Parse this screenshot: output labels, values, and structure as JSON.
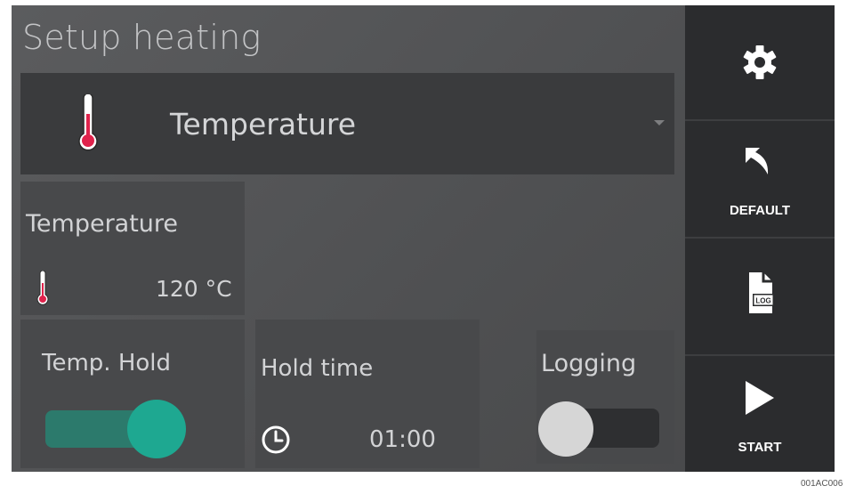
{
  "header": {
    "title": "Setup heating"
  },
  "mode_select": {
    "selected": "Temperature"
  },
  "temperature_tile": {
    "label": "Temperature",
    "value": "120 °C"
  },
  "temp_hold_tile": {
    "label": "Temp. Hold",
    "enabled": true
  },
  "hold_time_tile": {
    "label": "Hold time",
    "value": "01:00"
  },
  "logging_tile": {
    "label": "Logging",
    "enabled": false
  },
  "sidebar": {
    "settings": {
      "icon": "gear-icon"
    },
    "default": {
      "label": "DEFAULT",
      "icon": "undo-arrow-icon"
    },
    "log": {
      "icon": "log-file-icon"
    },
    "start": {
      "label": "START",
      "icon": "play-icon"
    }
  },
  "footer": {
    "code": "001AC006"
  },
  "colors": {
    "accent_teal": "#1ea891",
    "thermometer_red": "#e0234c",
    "panel_dark": "#2b2c2e"
  }
}
